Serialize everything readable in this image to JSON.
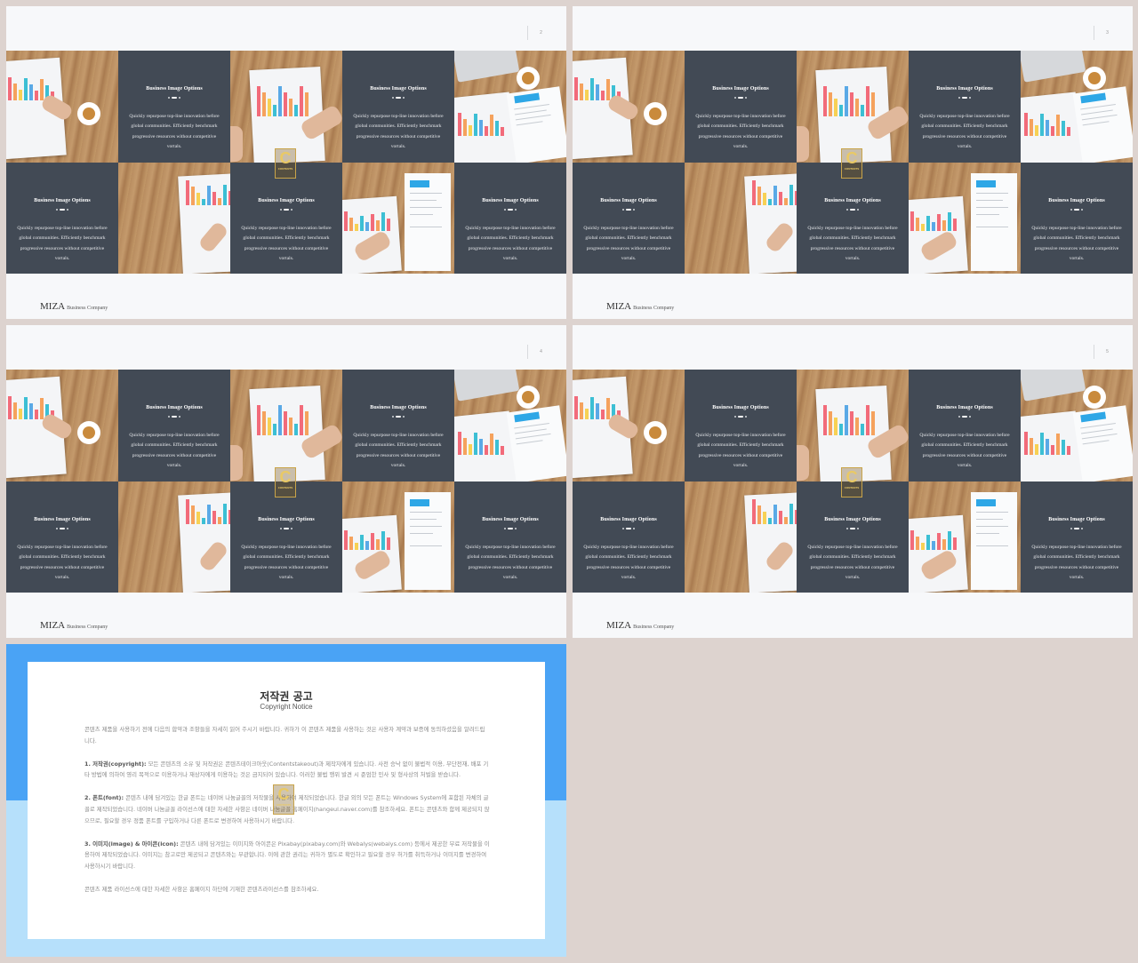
{
  "slides": [
    {
      "page_number": "2"
    },
    {
      "page_number": "3"
    },
    {
      "page_number": "4"
    },
    {
      "page_number": "5"
    }
  ],
  "panel": {
    "title": "Business Image Options",
    "text": "Quickly repurpose top-line innovation before global communities. Efficiently benchmark progressive resources without competitive vortals."
  },
  "footer": {
    "brand": "MIZA",
    "tagline": "Business Company"
  },
  "logo": {
    "letter": "C",
    "text": "CONTENTS"
  },
  "notice": {
    "title": "저작권 공고",
    "subtitle": "Copyright Notice",
    "intro": "콘텐츠 제품을 사용하기 전에 다음의 합약과 조항들을 자세히 읽어 주시기 바랍니다. 귀하가 이 콘텐츠 제품을 사용하는 것은 사용자 계약과 보증에 동의하셨음을 알려드립니다.",
    "p1_head": "1. 저작권(copyright):",
    "p1": " 모든 콘텐츠의 소유 및 저작권은 콘텐츠테이크아웃(Contentstakeout)과 제작자에게 있습니다. 사전 승낙 없이 불법적 이용, 무단전재, 배포 기타 방법에 의하여 영리 목적으로 이용하거나 재상자에게 이용하는 것은 금지되어 있습니다. 이러한 불법 행위 발견 시 준엄한 민사 및 형사상의 처벌을 받습니다.",
    "p2_head": "2. 폰트(font):",
    "p2": " 콘텐츠 내에 담겨있는 한글 폰트는 네이버 나눔글꼴의 저작물을 사용하여 제작되었습니다. 한글 외의 모든 폰트는 Windows System에 포함된 자체의 글꼴로 제작되었습니다. 네이버 나눔글꼴 라이선스에 대한 자세한 사항은 네이버 나눔글꼴 홈페이지(hangeul.naver.com)를 참조하세요. 폰트는 콘텐츠와 함께 제공되지 않으므로, 필요할 경우 정품 폰트를 구입하거나 다른 폰트로 변경하여 사용하시기 바랍니다.",
    "p3_head": "3. 이미지(image) & 아이콘(icon):",
    "p3": " 콘텐츠 내에 담겨있는 이미지와 아이콘은 Pixabay(pixabay.com)와 Webalys(webalys.com) 등에서 제공한 무료 저작물을 이용하여 제작되었습니다. 이미지는 참고로만 제공되고 콘텐츠와는 무관합니다. 이에 관한 권리는 귀하가 별도로 확인하고 필요할 경우 허가를 취득하거나 이미지를 변경하여 사용하시기 바랍니다.",
    "closing": "콘텐츠 제품 라이선스에 대한 자세한 사항은 홈페이지 하단에 기재한 콘텐츠라이선스를 참조하세요."
  },
  "colors": {
    "background": "#ddd3cf",
    "panel": "#424a55",
    "notice_top": "#4aa3f5",
    "notice_bottom": "#b6e0fb",
    "logo_gold": "#c9a44a"
  },
  "icons": [
    "contents-logo-icon"
  ]
}
